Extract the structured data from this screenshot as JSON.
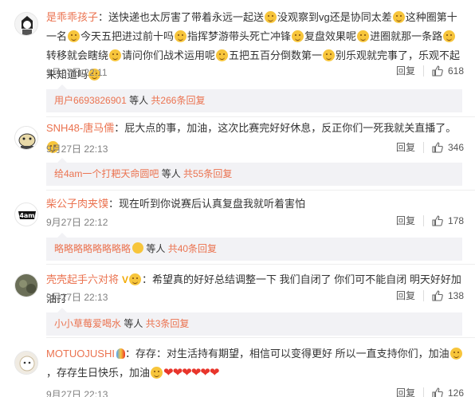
{
  "comments": [
    {
      "username": "是乖乖孩子",
      "text_parts": [
        "：送快递也太厉害了带着永远一起送",
        "没观察到vg还是协同太差",
        "这种圈第十一名",
        "今天五把进过前十吗",
        "指挥梦游带头死亡冲锋",
        "复盘效果呢",
        "进圈就那一条路",
        "转移就会瞎绕",
        "请问你们战术运用呢",
        "五把五百分倒数第一",
        "别乐观就完事了，乐观不起来知道吗"
      ],
      "time": "9月27日 22:11",
      "reply_label": "回复",
      "likes": "618",
      "sub_reply": {
        "user": "用户6693826901",
        "middle": " 等人 ",
        "count": "共266条回复"
      }
    },
    {
      "username": "SNH48-唐马儒",
      "text": "：屁大点的事，加油，这次比赛完好好休息，反正你们一死我就关直播了。",
      "time": "9月27日 22:13",
      "reply_label": "回复",
      "likes": "346",
      "sub_reply": {
        "user": "给4am一个打耙天命圆吧",
        "middle": " 等人 ",
        "count": "共55条回复"
      }
    },
    {
      "username": "柴公子肉夹馍",
      "text": "：现在听到你说赛后认真复盘我就听着害怕",
      "time": "9月27日 22:12",
      "reply_label": "回复",
      "likes": "178",
      "sub_reply": {
        "user": "略略略略略略略略",
        "middle": " 等人 ",
        "count": "共40条回复"
      }
    },
    {
      "username": "壳壳起手六对将",
      "text": "：希望真的好好总结调整一下 我们自闭了 你们可不能自闭 明天好好加油打",
      "time": "9月27日 22:13",
      "reply_label": "回复",
      "likes": "138",
      "sub_reply": {
        "user": "小小草莓爱喝水",
        "middle": " 等人 ",
        "count": "共3条回复"
      }
    },
    {
      "username": "MOTUOJUSHI",
      "text": "：存存：对生活持有期望，相信可以变得更好 所以一直支持你们，加油",
      "text_tail": "，存存生日快乐，加油",
      "hearts": "❤❤❤❤❤❤",
      "time": "9月27日 22:13",
      "reply_label": "回复",
      "likes": "126"
    }
  ],
  "colors": {
    "accent": "#eb7350",
    "heart": "#e8352b",
    "emoji": "#f7c53b",
    "sub_bg": "#f2f2f5"
  },
  "icons": {
    "like": "thumbs-up-icon",
    "emoji": "face-emoji-icon",
    "heart": "heart-icon"
  }
}
